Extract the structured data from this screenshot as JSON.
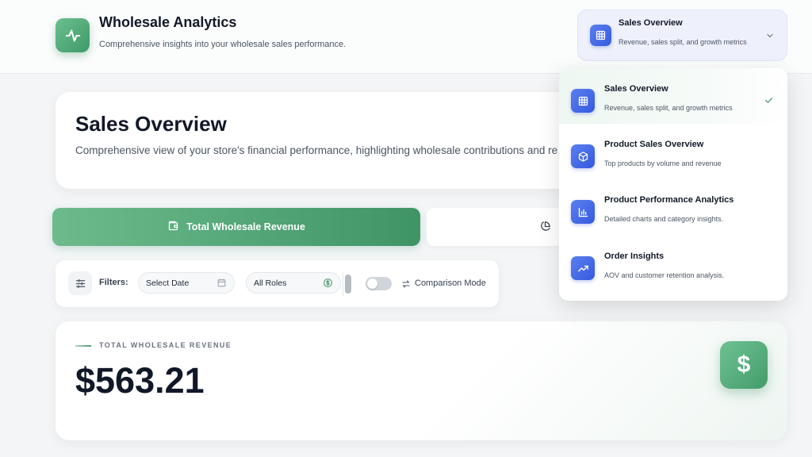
{
  "app": {
    "title": "Wholesale Analytics",
    "subtitle": "Comprehensive insights into your wholesale sales performance."
  },
  "nav_select": {
    "title": "Sales Overview",
    "subtitle": "Revenue, sales split, and growth metrics",
    "icon": "grid-icon"
  },
  "overview": {
    "title": "Sales Overview",
    "description": "Comprehensive view of your store's financial performance, highlighting wholesale contributions and re"
  },
  "tabs": [
    {
      "label": "Total Wholesale Revenue",
      "icon": "wallet-icon",
      "active": true
    },
    {
      "label": "",
      "icon": "pie-chart-icon",
      "active": false
    }
  ],
  "filters": {
    "label": "Filters:",
    "date_placeholder": "Select Date",
    "role_value": "All Roles",
    "comparison_label": "Comparison Mode",
    "comparison_enabled": false
  },
  "metric": {
    "label": "TOTAL WHOLESALE REVENUE",
    "value": "$563.21",
    "badge": "$"
  },
  "dropdown": {
    "items": [
      {
        "title": "Sales Overview",
        "subtitle": "Revenue, sales split, and growth metrics",
        "icon": "grid-icon",
        "selected": true
      },
      {
        "title": "Product Sales Overview",
        "subtitle": "Top products by volume and revenue",
        "icon": "box-icon",
        "selected": false
      },
      {
        "title": "Product Performance Analytics",
        "subtitle": "Detailed charts and category insights.",
        "icon": "bar-chart-icon",
        "selected": false
      },
      {
        "title": "Order Insights",
        "subtitle": "AOV and customer retention analysis.",
        "icon": "trending-up-icon",
        "selected": false
      }
    ]
  },
  "colors": {
    "brand_green": "#4f9f73",
    "accent_blue": "#3f63e4",
    "background": "#f3f5f7"
  }
}
